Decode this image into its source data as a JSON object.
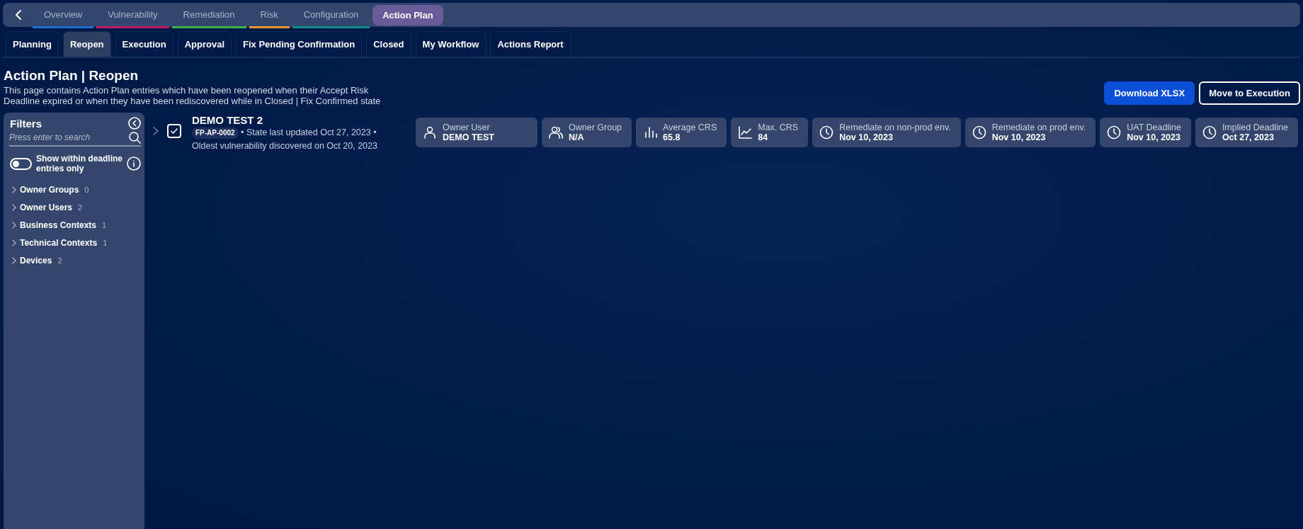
{
  "top_nav": {
    "tabs": [
      {
        "label": "Overview",
        "selected": false,
        "color": "#1f6fd1"
      },
      {
        "label": "Vulnerability",
        "selected": false,
        "color": "#c2185f"
      },
      {
        "label": "Remediation",
        "selected": false,
        "color": "#3bb54a"
      },
      {
        "label": "Risk",
        "selected": false,
        "color": "#f0952a"
      },
      {
        "label": "Configuration",
        "selected": false,
        "color": "#138a8a"
      },
      {
        "label": "Action Plan",
        "selected": true,
        "color": "#6b5a9a"
      }
    ]
  },
  "sub_tabs": [
    {
      "label": "Planning",
      "selected": false
    },
    {
      "label": "Reopen",
      "selected": true
    },
    {
      "label": "Execution",
      "selected": false
    },
    {
      "label": "Approval",
      "selected": false
    },
    {
      "label": "Fix Pending Confirmation",
      "selected": false
    },
    {
      "label": "Closed",
      "selected": false
    },
    {
      "label": "My Workflow",
      "selected": false
    },
    {
      "label": "Actions Report",
      "selected": false
    }
  ],
  "page": {
    "title": "Action Plan | Reopen",
    "description": "This page contains Action Plan entries which have been reopened when their Accept Risk Deadline expired or when they have been rediscovered while in Closed | Fix Confirmed state",
    "buttons": [
      {
        "label": "Download XLSX",
        "kind": "primary"
      },
      {
        "label": "Move to Execution",
        "kind": "outline"
      }
    ]
  },
  "filters": {
    "title": "Filters",
    "search": {
      "placeholder": "Press enter to search"
    },
    "toggle": {
      "label": "Show within deadline entries only",
      "on": false
    },
    "groups": [
      {
        "label": "Owner Groups",
        "count": "0",
        "expanded": false
      },
      {
        "label": "Owner Users",
        "count": "2",
        "expanded": false
      },
      {
        "label": "Business Contexts",
        "count": "1",
        "expanded": false
      },
      {
        "label": "Technical Contexts",
        "count": "1",
        "expanded": false
      },
      {
        "label": "Devices",
        "count": "2",
        "expanded": false
      }
    ]
  },
  "entries": [
    {
      "title": "DEMO TEST 2",
      "checked": true,
      "expanded": false,
      "id": "FP-AP-0002",
      "state_text": "• State last updated Oct 27, 2023 •",
      "oldest_text": "Oldest vulnerability discovered on Oct 20, 2023",
      "stats": [
        {
          "kind": "user",
          "label": "Owner User",
          "value": "DEMO TEST"
        },
        {
          "kind": "group",
          "label": "Owner Group",
          "value": "N/A"
        },
        {
          "kind": "bars",
          "label": "Average CRS",
          "value": "65.8"
        },
        {
          "kind": "line",
          "label": "Max. CRS",
          "value": "84"
        },
        {
          "kind": "clock",
          "label": "Remediate on non-prod env.",
          "value": "Nov 10, 2023"
        },
        {
          "kind": "clock",
          "label": "Remediate on prod env.",
          "value": "Nov 10, 2023"
        },
        {
          "kind": "clock",
          "label": "UAT Deadline",
          "value": "Nov 10, 2023"
        },
        {
          "kind": "clock",
          "label": "Implied Deadline",
          "value": "Oct 27, 2023"
        }
      ]
    }
  ]
}
